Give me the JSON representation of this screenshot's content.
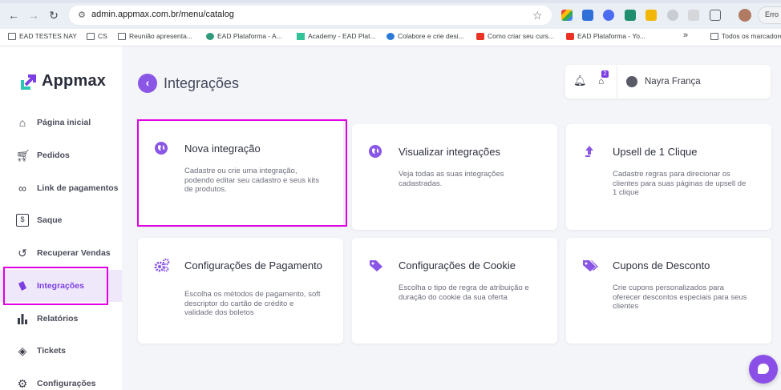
{
  "browser": {
    "url": "admin.appmax.com.br/menu/catalog",
    "profile_status": "Erro",
    "bookmarks": [
      {
        "label": "EAD TESTES NAY",
        "icon": "folder-icon"
      },
      {
        "label": "CS",
        "icon": "folder-icon"
      },
      {
        "label": "Reunião apresenta...",
        "icon": "folder-icon"
      },
      {
        "label": "EAD Plataforma - A...",
        "icon": "globe-icon"
      },
      {
        "label": "Academy - EAD Plat...",
        "icon": "site-icon"
      },
      {
        "label": "Colabore e crie desi...",
        "icon": "canva-icon"
      },
      {
        "label": "Como criar seu curs...",
        "icon": "youtube-icon"
      },
      {
        "label": "EAD Plataforma - Yo...",
        "icon": "youtube-icon"
      },
      {
        "label": "Todos os marcadores",
        "icon": "folder-icon"
      }
    ],
    "overflow_label": "»"
  },
  "brand": {
    "name": "Appmax"
  },
  "sidebar": {
    "items": [
      {
        "label": "Página inicial",
        "icon": "home-icon"
      },
      {
        "label": "Pedidos",
        "icon": "cart-icon"
      },
      {
        "label": "Link de pagamentos",
        "icon": "link-icon"
      },
      {
        "label": "Saque",
        "icon": "cash-icon"
      },
      {
        "label": "Recuperar Vendas",
        "icon": "recover-icon"
      },
      {
        "label": "Integrações",
        "icon": "puzzle-icon",
        "active": true
      },
      {
        "label": "Relatórios",
        "icon": "bar-chart-icon"
      },
      {
        "label": "Tickets",
        "icon": "ticket-icon"
      },
      {
        "label": "Configurações",
        "icon": "gear-icon"
      }
    ]
  },
  "page": {
    "title": "Integrações",
    "back_icon": "chevron-left-icon"
  },
  "userbar": {
    "cart_badge": "2",
    "user_name": "Nayra França"
  },
  "cards": [
    {
      "title": "Nova integração",
      "desc": "Cadastre ou crie uma integração, podendo editar seu cadastro e seus kits de produtos.",
      "icon": "globe-icon"
    },
    {
      "title": "Visualizar integrações",
      "desc": "Veja todas as suas integrações cadastradas.",
      "icon": "globe-icon"
    },
    {
      "title": "Upsell de 1 Clique",
      "desc": "Cadastre regras para direcionar os clientes para suas páginas de upsell de 1 clique",
      "icon": "arrow-up-icon"
    },
    {
      "title": "Configurações de Pagamento",
      "desc": "Escolha os métodos de pagamento, soft descriptor do cartão de crédito e validade dos boletos",
      "icon": "gears-icon"
    },
    {
      "title": "Configurações de Cookie",
      "desc": "Escolha o tipo de regra de atribuição e duração do cookie da sua oferta",
      "icon": "tag-icon"
    },
    {
      "title": "Cupons de Desconto",
      "desc": "Crie cupons personalizados para oferecer descontos especiais para seus clientes",
      "icon": "tags-icon"
    }
  ],
  "colors": {
    "accent": "#8a56e6",
    "highlight": "#e000e0",
    "active_bg": "#efe8fb"
  }
}
